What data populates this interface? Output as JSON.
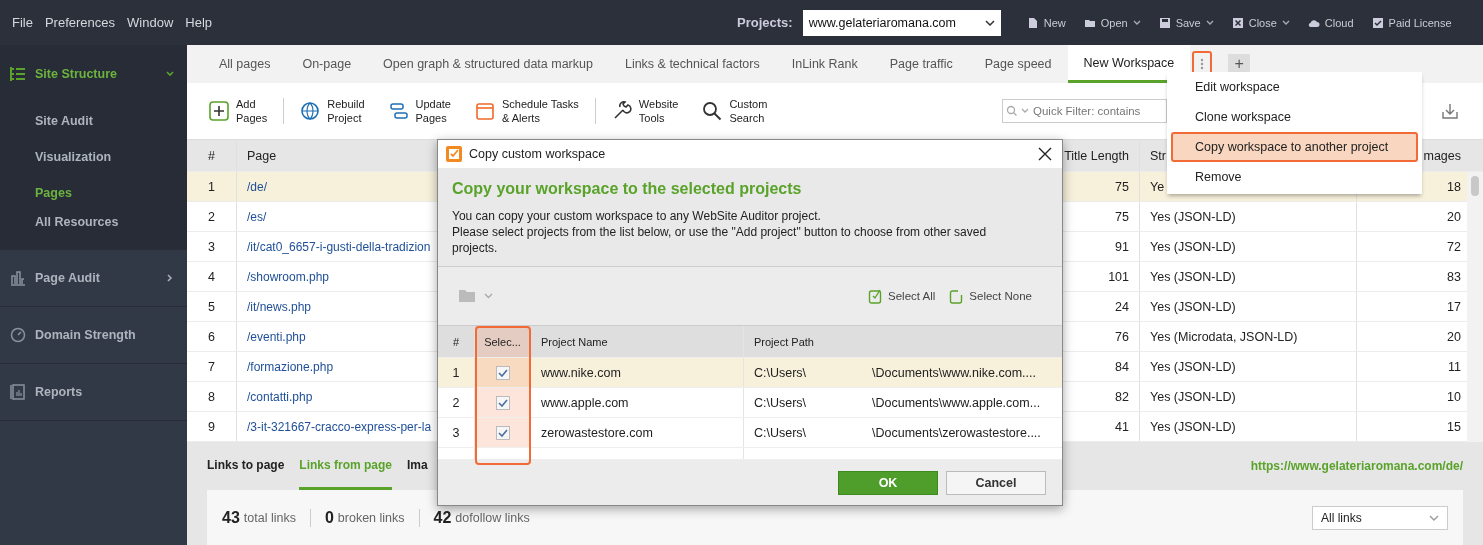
{
  "menu": [
    "File",
    "Preferences",
    "Window",
    "Help"
  ],
  "projects": {
    "label": "Projects:",
    "value": "www.gelateriaromana.com"
  },
  "top_buttons": [
    {
      "kind": "new",
      "label": "New",
      "has_menu": false
    },
    {
      "kind": "open",
      "label": "Open",
      "has_menu": true
    },
    {
      "kind": "save",
      "label": "Save",
      "has_menu": true
    },
    {
      "kind": "close",
      "label": "Close",
      "has_menu": true
    },
    {
      "kind": "cloud",
      "label": "Cloud",
      "has_menu": false
    },
    {
      "kind": "license",
      "label": "Paid License",
      "has_menu": false
    }
  ],
  "sidebar": [
    {
      "kind": "structure",
      "label": "Site Structure",
      "expanded": true,
      "children": [
        {
          "label": "Site Audit",
          "selected": false
        },
        {
          "label": "Visualization",
          "selected": false
        },
        {
          "label": "Pages",
          "selected": true
        },
        {
          "label": "All Resources",
          "selected": false
        }
      ]
    },
    {
      "kind": "audit",
      "label": "Page Audit",
      "expanded": false
    },
    {
      "kind": "domain",
      "label": "Domain Strength"
    },
    {
      "kind": "reports",
      "label": "Reports"
    }
  ],
  "tabs": [
    {
      "label": "All pages",
      "selected": false
    },
    {
      "label": "On-page",
      "selected": false
    },
    {
      "label": "Open graph & structured data markup",
      "selected": false
    },
    {
      "label": "Links & technical factors",
      "selected": false
    },
    {
      "label": "InLink Rank",
      "selected": false
    },
    {
      "label": "Page traffic",
      "selected": false
    },
    {
      "label": "Page speed",
      "selected": false
    },
    {
      "label": "New Workspace",
      "selected": true
    }
  ],
  "tab_menu_button": {
    "highlighted": true
  },
  "add_tab": "+",
  "toolbar": [
    {
      "kind": "add",
      "label": "Add\nPages"
    },
    {
      "kind": "rebuild",
      "label": "Rebuild\nProject"
    },
    {
      "kind": "update",
      "label": "Update\nPages"
    },
    {
      "kind": "schedule",
      "label": "Schedule Tasks\n& Alerts"
    },
    {
      "kind": "tools",
      "label": "Website\nTools"
    },
    {
      "kind": "search",
      "label": "Custom\nSearch"
    }
  ],
  "quick_filter": {
    "placeholder": "Quick Filter: contains"
  },
  "table": {
    "columns": [
      "#",
      "Page",
      "Title Length",
      "Str",
      "mages"
    ],
    "rows": [
      {
        "n": "1",
        "page": "/de/",
        "title_length": "75",
        "structured": "Ye",
        "images": "18",
        "selected": true
      },
      {
        "n": "2",
        "page": "/es/",
        "title_length": "75",
        "structured": "Yes (JSON-LD)",
        "images": "20",
        "selected": false
      },
      {
        "n": "3",
        "page": "/it/cat0_6657-i-gusti-della-tradizion",
        "title_length": "91",
        "structured": "Yes (JSON-LD)",
        "images": "72",
        "selected": false
      },
      {
        "n": "4",
        "page": "/showroom.php",
        "title_length": "101",
        "structured": "Yes (JSON-LD)",
        "images": "83",
        "selected": false
      },
      {
        "n": "5",
        "page": "/it/news.php",
        "title_length": "24",
        "structured": "Yes (JSON-LD)",
        "images": "17",
        "selected": false
      },
      {
        "n": "6",
        "page": "/eventi.php",
        "title_length": "76",
        "structured": "Yes (Microdata, JSON-LD)",
        "images": "20",
        "selected": false
      },
      {
        "n": "7",
        "page": "/formazione.php",
        "title_length": "84",
        "structured": "Yes (JSON-LD)",
        "images": "11",
        "selected": false
      },
      {
        "n": "8",
        "page": "/contatti.php",
        "title_length": "82",
        "structured": "Yes (JSON-LD)",
        "images": "10",
        "selected": false
      },
      {
        "n": "9",
        "page": "/3-it-321667-cracco-express-per-la",
        "title_length": "41",
        "structured": "Yes (JSON-LD)",
        "images": "15",
        "selected": false
      }
    ]
  },
  "bottom": {
    "tabs": [
      {
        "label": "Links to page",
        "selected": false
      },
      {
        "label": "Links from page",
        "selected": true
      },
      {
        "label": "Ima",
        "selected": false
      }
    ],
    "url": "https://www.gelateriaromana.com/de/",
    "stats": [
      {
        "value": "43",
        "label": "total links"
      },
      {
        "value": "0",
        "label": "broken links"
      },
      {
        "value": "42",
        "label": "dofollow links"
      }
    ],
    "filter": "All links"
  },
  "context_menu": [
    {
      "label": "Edit workspace",
      "selected": false
    },
    {
      "label": "Clone workspace",
      "selected": false
    },
    {
      "label": "Copy workspace to another project",
      "selected": true
    },
    {
      "label": "Remove",
      "selected": false
    }
  ],
  "dialog": {
    "title": "Copy custom workspace",
    "heading": "Copy your workspace to the selected projects",
    "paragraphs": [
      "You can copy your custom workspace to any WebSite Auditor project.",
      "Please select projects from the list below, or use the \"Add project\" button to choose from other saved projects."
    ],
    "select_all": "Select All",
    "select_none": "Select None",
    "columns": [
      {
        "label": "#"
      },
      {
        "label": "Selec...",
        "highlighted": true
      },
      {
        "label": "Project Name"
      },
      {
        "label": "Project Path"
      }
    ],
    "rows": [
      {
        "n": "1",
        "checked": true,
        "name": "www.nike.com",
        "path_start": "C:\\Users\\",
        "path_end": "\\Documents\\www.nike.com....",
        "selected": true
      },
      {
        "n": "2",
        "checked": true,
        "name": "www.apple.com",
        "path_start": "C:\\Users\\",
        "path_end": "\\Documents\\www.apple.com...",
        "selected": false
      },
      {
        "n": "3",
        "checked": true,
        "name": "zerowastestore.com",
        "path_start": "C:\\Users\\",
        "path_end": "\\Documents\\zerowastestore....",
        "selected": false
      }
    ],
    "ok": "OK",
    "cancel": "Cancel"
  }
}
